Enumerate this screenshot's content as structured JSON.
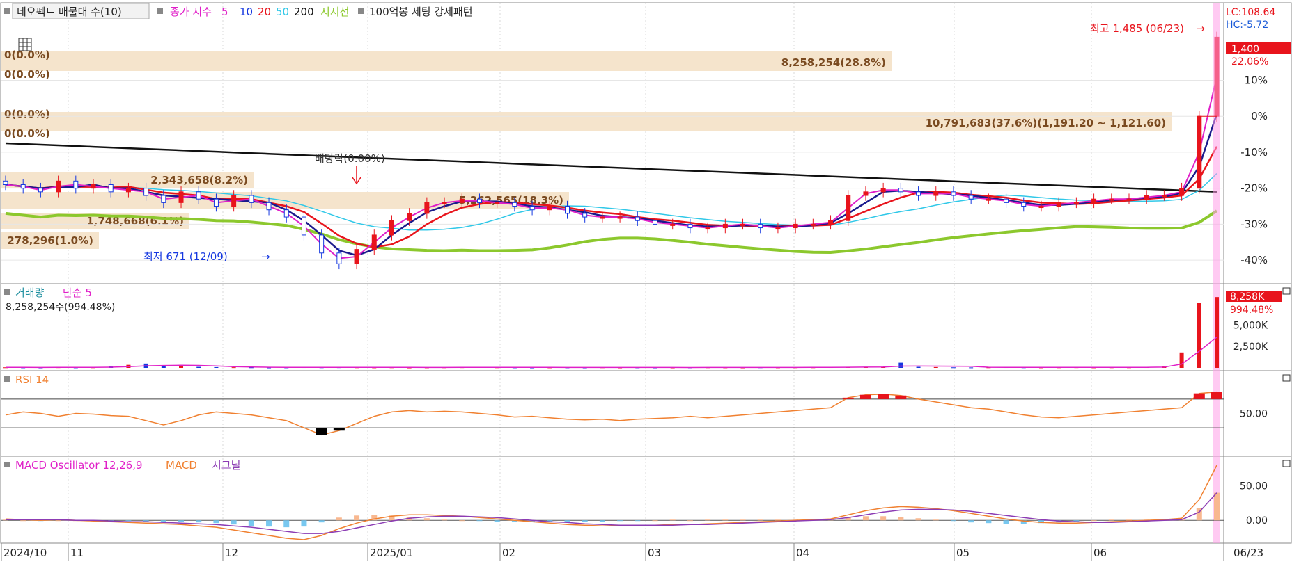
{
  "legend": {
    "main_prefix": "네오펙트 매물대 수(10)",
    "ma_label": "종가 지수",
    "ma_periods": [
      "5",
      "10",
      "20",
      "50",
      "200"
    ],
    "support_label": "지지선",
    "pattern_label": "100억봉 세팅 강세패턴"
  },
  "colors": {
    "up": "#e8141c",
    "down": "#1437e0",
    "ma5": "#e020c8",
    "ma10": "#1a1a8c",
    "ma20": "#e8141c",
    "ma50": "#30c8e8",
    "ma200": "#111111",
    "support": "#8cc82d",
    "volume_band": "#f5e4cc",
    "highlight": "#ff9ee8",
    "rsi_line": "#f08030",
    "macd_line": "#f08030",
    "signal_line": "#8c3cb4",
    "osc_pos": "#f8b890",
    "osc_neg": "#78c8f0"
  },
  "right_info": {
    "lc": "LC:108.64",
    "hc": "HC:-5.72",
    "price_box": "1,400",
    "pct": "22.06%"
  },
  "chart_data": [
    {
      "type": "candlestick",
      "y_axis": "percent",
      "ylim": [
        -45,
        30
      ],
      "y_ticks": [
        "10%",
        "0%",
        "-10%",
        "-20%",
        "-30%",
        "-40%"
      ],
      "y_tick_values": [
        10,
        0,
        -10,
        -20,
        -30,
        -40
      ],
      "x_ticks": [
        "2024/10",
        "11",
        "12",
        "2025/01",
        "02",
        "03",
        "04",
        "05",
        "06",
        "06/23"
      ],
      "annotations": {
        "high": "최고 1,485 (06/23)",
        "low": "최저 671 (12/09)",
        "dividend": "배당락(0.00%)"
      },
      "volume_profile": [
        {
          "label": "8,258,254(28.8%)",
          "zero_labels": [
            "0(0.0%)",
            "0(0.0%)"
          ]
        },
        {
          "label": "10,791,683(37.6%)(1,191.20 ~ 1,121.60)",
          "zero_labels": [
            "0(0.0%)",
            "0(0.0%)"
          ]
        },
        {
          "label": "2,343,658(8.2%)"
        },
        {
          "label": "5,262,565(18.3%)"
        },
        {
          "label": "1,748,668(6.1%)"
        },
        {
          "label": "278,296(1.0%)"
        }
      ],
      "series": [
        {
          "name": "종가",
          "values": [
            -19,
            -20,
            -21,
            -18,
            -20,
            -19,
            -21,
            -20,
            -22,
            -24,
            -21,
            -23,
            -25,
            -22,
            -24,
            -26,
            -28,
            -33,
            -38,
            -41,
            -37,
            -33,
            -29,
            -27,
            -24,
            -24,
            -23,
            -24,
            -24,
            -25,
            -26,
            -25,
            -27,
            -28,
            -28,
            -28,
            -29,
            -30,
            -30,
            -31,
            -31,
            -30,
            -30,
            -31,
            -31,
            -30,
            -30,
            -29,
            -22,
            -21,
            -20,
            -21,
            -22,
            -21,
            -22,
            -23,
            -23,
            -24,
            -25,
            -25,
            -24,
            -24,
            -23,
            -23,
            -23,
            -22,
            -22,
            -20,
            0,
            22
          ]
        }
      ]
    },
    {
      "type": "bar",
      "title": "거래량",
      "ma_label": "단순 5",
      "subtitle": "8,258,254주(994.48%)",
      "y_ticks": [
        "5,000K",
        "2,500K"
      ],
      "y_tick_values": [
        5000,
        2500
      ],
      "last_value": "8,258K",
      "last_pct": "994.48%",
      "ylim": [
        0,
        9000
      ],
      "values": [
        60,
        50,
        40,
        70,
        50,
        60,
        200,
        350,
        500,
        260,
        180,
        120,
        90,
        70,
        60,
        40,
        50,
        80,
        60,
        70,
        60,
        50,
        60,
        40,
        50,
        60,
        70,
        100,
        60,
        50,
        40,
        50,
        50,
        40,
        60,
        40,
        50,
        40,
        40,
        50,
        60,
        50,
        40,
        60,
        50,
        60,
        60,
        80,
        120,
        110,
        100,
        600,
        120,
        90,
        60,
        50,
        60,
        80,
        60,
        50,
        60,
        70,
        50,
        60,
        60,
        80,
        200,
        1800,
        7600,
        8258
      ]
    },
    {
      "type": "line",
      "title": "RSI 14",
      "y_ticks": [
        "50.00"
      ],
      "y_tick_values": [
        50
      ],
      "ylim": [
        0,
        100
      ],
      "values": [
        48,
        52,
        50,
        46,
        50,
        49,
        47,
        46,
        40,
        34,
        40,
        48,
        52,
        50,
        48,
        44,
        40,
        30,
        20,
        26,
        36,
        46,
        52,
        54,
        52,
        53,
        52,
        50,
        48,
        45,
        46,
        44,
        42,
        41,
        42,
        40,
        42,
        43,
        44,
        46,
        44,
        46,
        48,
        50,
        52,
        54,
        56,
        58,
        72,
        76,
        77,
        75,
        70,
        66,
        62,
        58,
        56,
        52,
        48,
        45,
        44,
        46,
        48,
        50,
        52,
        54,
        56,
        58,
        78,
        80
      ]
    },
    {
      "type": "line",
      "title": "MACD Oscillator 12,26,9",
      "series_names": [
        "MACD",
        "시그널"
      ],
      "y_ticks": [
        "50.00",
        "0.00"
      ],
      "y_tick_values": [
        50,
        0
      ],
      "ylim": [
        -25,
        85
      ],
      "macd": [
        2,
        1,
        0,
        1,
        0,
        -1,
        -2,
        -3,
        -4,
        -5,
        -6,
        -8,
        -10,
        -14,
        -18,
        -22,
        -26,
        -28,
        -22,
        -12,
        -4,
        2,
        6,
        8,
        8,
        7,
        6,
        4,
        2,
        0,
        -2,
        -4,
        -6,
        -7,
        -8,
        -8,
        -8,
        -7,
        -6,
        -6,
        -5,
        -4,
        -3,
        -2,
        -1,
        0,
        1,
        2,
        8,
        14,
        18,
        20,
        19,
        17,
        14,
        10,
        6,
        2,
        -1,
        -3,
        -4,
        -4,
        -3,
        -2,
        -1,
        0,
        1,
        3,
        30,
        80
      ],
      "signal": [
        1,
        1,
        1,
        1,
        0,
        0,
        -1,
        -2,
        -2,
        -3,
        -4,
        -5,
        -6,
        -8,
        -10,
        -13,
        -16,
        -19,
        -19,
        -16,
        -11,
        -6,
        -1,
        3,
        5,
        6,
        6,
        5,
        4,
        2,
        0,
        -2,
        -3,
        -5,
        -6,
        -7,
        -7,
        -7,
        -7,
        -6,
        -6,
        -5,
        -4,
        -3,
        -2,
        -1,
        0,
        1,
        4,
        8,
        12,
        15,
        16,
        16,
        15,
        13,
        10,
        7,
        4,
        1,
        -1,
        -2,
        -3,
        -3,
        -2,
        -1,
        0,
        1,
        12,
        40
      ]
    }
  ]
}
